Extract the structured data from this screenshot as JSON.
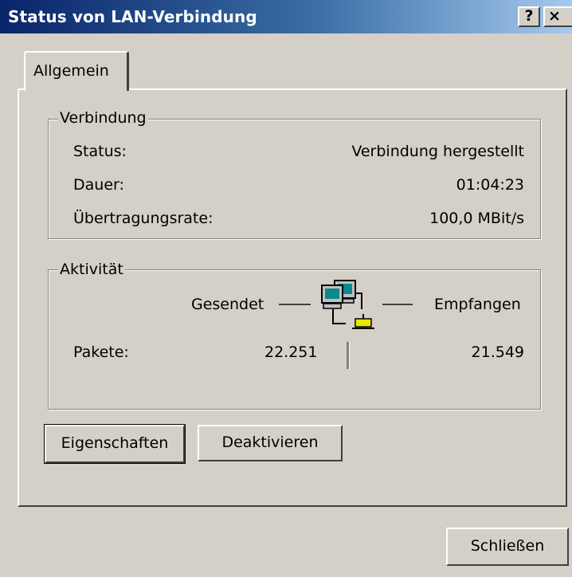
{
  "window": {
    "title": "Status von LAN-Verbindung"
  },
  "titlebar": {
    "help_glyph": "?",
    "close_glyph": "×"
  },
  "tabs": [
    {
      "label": "Allgemein",
      "selected": true
    }
  ],
  "connection": {
    "legend": "Verbindung",
    "rows": [
      {
        "label": "Status:",
        "value": "Verbindung hergestellt"
      },
      {
        "label": "Dauer:",
        "value": "01:04:23"
      },
      {
        "label": "Übertragungsrate:",
        "value": "100,0 MBit/s"
      }
    ]
  },
  "activity": {
    "legend": "Aktivität",
    "sent_label": "Gesendet",
    "received_label": "Empfangen",
    "packets_label": "Pakete:",
    "packets_sent": "22.251",
    "packets_received": "21.549",
    "icon": "network-activity-icon"
  },
  "buttons": {
    "properties": "Eigenschaften",
    "disable": "Deaktivieren",
    "close": "Schließen"
  },
  "colors": {
    "titlebar_start": "#0a246a",
    "titlebar_end": "#a6caf0",
    "face": "#d4d0c8"
  }
}
